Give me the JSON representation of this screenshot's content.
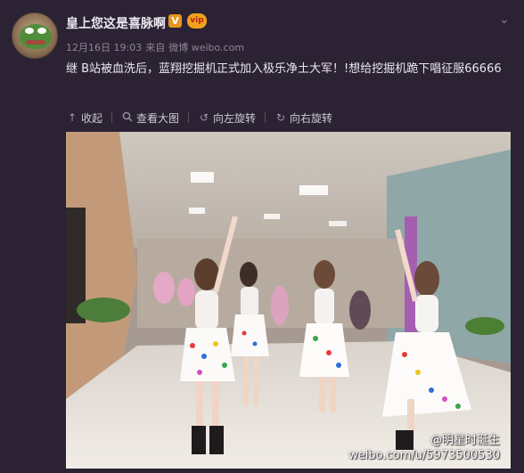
{
  "post": {
    "username": "皇上您这是喜脉啊",
    "verified_badge": "V",
    "vip_badge": "vip",
    "date": "12月16日 19:03",
    "source_prefix": "来自",
    "source": "微博 weibo.com",
    "text": "继 B站被血洗后，蓝翔挖掘机正式加入极乐净土大军！!想给挖掘机跪下唱征服66666"
  },
  "toolbar": {
    "collapse": "收起",
    "view_large": "查看大图",
    "rotate_left": "向左旋转",
    "rotate_right": "向右旋转"
  },
  "icons": {
    "collapse": "up-arrow-icon",
    "view_large": "magnify-icon",
    "rotate_left": "rotate-left-icon",
    "rotate_right": "rotate-right-icon",
    "more": "chevron-down-icon"
  },
  "watermark": {
    "name": "@明星时涎生",
    "url": "weibo.com/u/5973500530"
  },
  "colors": {
    "background": "#2b2233",
    "text": "#ece6ef",
    "meta": "#8d8595",
    "verified": "#e8961c"
  }
}
